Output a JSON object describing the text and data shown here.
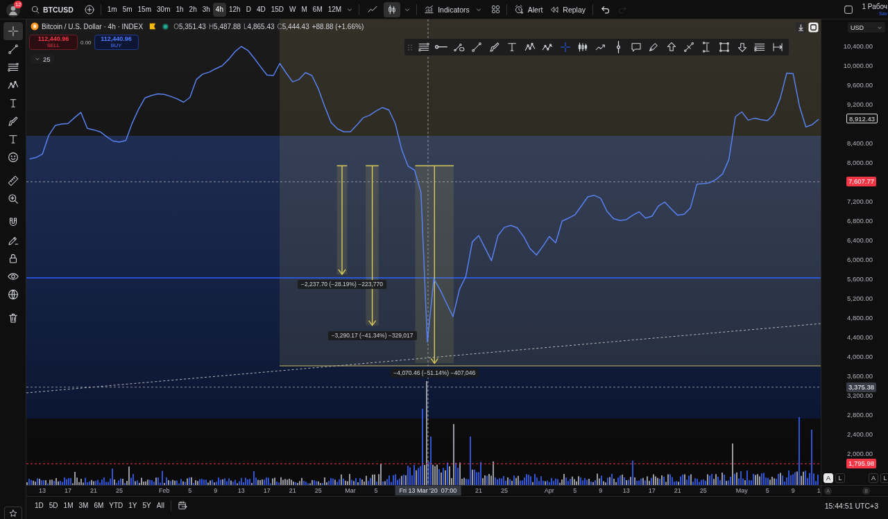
{
  "top_toolbar": {
    "notification_count": "12",
    "symbol": "BTCUSD",
    "intervals": [
      {
        "label": "1m",
        "selected": false
      },
      {
        "label": "5m",
        "selected": false
      },
      {
        "label": "15m",
        "selected": false
      },
      {
        "label": "30m",
        "selected": false
      },
      {
        "label": "1h",
        "selected": false
      },
      {
        "label": "2h",
        "selected": false
      },
      {
        "label": "3h",
        "selected": false
      },
      {
        "label": "4h",
        "selected": true
      },
      {
        "label": "12h",
        "selected": false
      },
      {
        "label": "D",
        "selected": false
      },
      {
        "label": "4D",
        "selected": false
      },
      {
        "label": "15D",
        "selected": false
      },
      {
        "label": "W",
        "selected": false
      },
      {
        "label": "M",
        "selected": false
      },
      {
        "label": "6M",
        "selected": false
      },
      {
        "label": "12M",
        "selected": false
      }
    ],
    "chart_types": [
      {
        "kind": "line",
        "selected": false
      },
      {
        "kind": "candles",
        "selected": true
      }
    ],
    "indicators_label": "Indicators",
    "alert_label": "Alert",
    "replay_label": "Replay",
    "history": [
      {
        "kind": "undo",
        "disabled": false
      },
      {
        "kind": "redo",
        "disabled": true
      }
    ],
    "layout_name": "1 Рабоч",
    "save_status": "Sav"
  },
  "left_toolbar": {
    "groups": [
      {
        "tools": [
          {
            "kind": "crosshair",
            "selected": true
          },
          {
            "kind": "trend-line",
            "selected": false
          },
          {
            "kind": "fib-lines",
            "selected": false
          },
          {
            "kind": "xabcd",
            "selected": false
          },
          {
            "kind": "projection",
            "selected": false
          },
          {
            "kind": "brush",
            "selected": false
          },
          {
            "kind": "text",
            "selected": false
          },
          {
            "kind": "emoji",
            "selected": false
          }
        ]
      },
      {
        "tools": [
          {
            "kind": "ruler",
            "selected": false
          },
          {
            "kind": "zoom-in",
            "selected": false
          }
        ]
      },
      {
        "tools": [
          {
            "kind": "magnet",
            "selected": false
          },
          {
            "kind": "draw-mode",
            "selected": false
          },
          {
            "kind": "lock",
            "selected": false
          },
          {
            "kind": "eye",
            "selected": false
          },
          {
            "kind": "object-tree",
            "selected": false
          }
        ]
      },
      {
        "tools": [
          {
            "kind": "trash",
            "selected": false
          }
        ]
      }
    ]
  },
  "legend": {
    "title": "Bitcoin / U.S. Dollar · 4h · INDEX",
    "ohlc": [
      {
        "key": "O",
        "value": "5,351.43"
      },
      {
        "key": "H",
        "value": "5,487.88"
      },
      {
        "key": "L",
        "value": "4,865.43"
      },
      {
        "key": "C",
        "value": "5,444.43"
      }
    ],
    "change": "+88.88 (+1.66%)"
  },
  "trade": {
    "sell": {
      "price": "112,440.96",
      "label": "SELL"
    },
    "spread": "0.00",
    "buy": {
      "price": "112,440.96",
      "label": "BUY"
    }
  },
  "collapse_toggle": {
    "count": "25"
  },
  "drawing_toolbar": {
    "tools": [
      {
        "kind": "fib-lines",
        "selected": false
      },
      {
        "kind": "ray",
        "selected": false
      },
      {
        "kind": "info-line",
        "selected": false
      },
      {
        "kind": "trend-line",
        "selected": false
      },
      {
        "kind": "brush",
        "selected": false
      },
      {
        "kind": "text",
        "selected": false
      },
      {
        "kind": "xabcd",
        "selected": false
      },
      {
        "kind": "abcd",
        "selected": false
      },
      {
        "kind": "crosshair",
        "selected": true
      },
      {
        "kind": "bars",
        "selected": false
      },
      {
        "kind": "forecast",
        "selected": false
      },
      {
        "kind": "vertical-line",
        "selected": false
      },
      {
        "kind": "callout",
        "selected": false
      },
      {
        "kind": "pen",
        "selected": false
      },
      {
        "kind": "arrow-up",
        "selected": false
      },
      {
        "kind": "parallel",
        "selected": false
      },
      {
        "kind": "price-range",
        "selected": false
      },
      {
        "kind": "rectangle",
        "selected": false
      },
      {
        "kind": "arrow-down",
        "selected": false
      },
      {
        "kind": "fib-channel",
        "selected": false
      },
      {
        "kind": "date-range",
        "selected": false
      }
    ]
  },
  "chart": {
    "currency": "USD",
    "chart_data": {
      "type": "line",
      "categories": [
        null,
        null,
        "13",
        null,
        null,
        null,
        "17",
        null,
        null,
        null,
        "21",
        null,
        null,
        null,
        "25",
        null,
        null,
        null,
        null,
        null,
        null,
        "Feb",
        null,
        null,
        null,
        "5",
        null,
        null,
        null,
        "9",
        null,
        null,
        null,
        "13",
        null,
        null,
        null,
        "17",
        null,
        null,
        null,
        "21",
        null,
        null,
        null,
        "25",
        null,
        null,
        null,
        null,
        "Mar",
        null,
        null,
        null,
        "5",
        null,
        null,
        null,
        null,
        null,
        null,
        null,
        null,
        null,
        null,
        null,
        null,
        null,
        null,
        null,
        "21",
        null,
        null,
        null,
        "25",
        null,
        null,
        null,
        null,
        null,
        null,
        "Apr",
        null,
        null,
        null,
        "5",
        null,
        null,
        null,
        "9",
        null,
        null,
        null,
        "13",
        null,
        null,
        null,
        "17",
        null,
        null,
        null,
        "21",
        null,
        null,
        null,
        "25",
        null,
        null,
        null,
        null,
        null,
        "May",
        null,
        null,
        null,
        "5",
        null,
        null,
        null,
        "9",
        null,
        null,
        null,
        "1"
      ],
      "series": [
        {
          "color": "#5a82f0",
          "values": [
            8080,
            8110,
            8180,
            8570,
            8770,
            8800,
            8810,
            8930,
            9040,
            8710,
            8680,
            8640,
            8540,
            8450,
            8430,
            8460,
            8820,
            9110,
            9340,
            9390,
            9420,
            9410,
            9370,
            9320,
            9250,
            9350,
            9720,
            9830,
            9870,
            9940,
            10000,
            10130,
            10290,
            10400,
            10320,
            10160,
            9980,
            9810,
            9800,
            10050,
            9850,
            9670,
            9720,
            9860,
            9800,
            9530,
            9160,
            8830,
            8700,
            8640,
            8640,
            8780,
            8930,
            8980,
            9070,
            9140,
            9090,
            8810,
            8270,
            7930,
            7850,
            7390,
            4300,
            5610,
            5380,
            5100,
            4830,
            5390,
            5660,
            6370,
            6500,
            6240,
            5980,
            6500,
            6670,
            6710,
            6660,
            6480,
            6230,
            6100,
            6280,
            6480,
            6350,
            6800,
            6860,
            6930,
            7110,
            7300,
            7330,
            7270,
            7000,
            6850,
            6810,
            6830,
            6920,
            6990,
            6860,
            6900,
            7110,
            7190,
            7050,
            6920,
            6940,
            7070,
            7560,
            7570,
            7590,
            7660,
            7770,
            8070,
            8950,
            9050,
            8880,
            8920,
            8890,
            8870,
            9000,
            9330,
            9850,
            9840,
            9160,
            8740,
            8790,
            8900
          ]
        }
      ],
      "ylim": [
        1357,
        10957
      ],
      "yticks": [
        {
          "value": 10400,
          "label": "10,400.00"
        },
        {
          "value": 10000,
          "label": "10,000.00"
        },
        {
          "value": 9600,
          "label": "9,600.00"
        },
        {
          "value": 9200,
          "label": "9,200.00"
        },
        {
          "value": 8400,
          "label": "8,400.00"
        },
        {
          "value": 8000,
          "label": "8,000.00"
        },
        {
          "value": 7200,
          "label": "7,200.00"
        },
        {
          "value": 6800,
          "label": "6,800.00"
        },
        {
          "value": 6400,
          "label": "6,400.00"
        },
        {
          "value": 6000,
          "label": "6,000.00"
        },
        {
          "value": 5600,
          "label": "5,600.00"
        },
        {
          "value": 5200,
          "label": "5,200.00"
        },
        {
          "value": 4800,
          "label": "4,800.00"
        },
        {
          "value": 4400,
          "label": "4,400.00"
        },
        {
          "value": 4000,
          "label": "4,000.00"
        },
        {
          "value": 3600,
          "label": "3,600.00"
        },
        {
          "value": 3200,
          "label": "3,200.00"
        },
        {
          "value": 2800,
          "label": "2,800.00"
        },
        {
          "value": 2400,
          "label": "2,400.00"
        },
        {
          "value": 2000,
          "label": "2,000.00"
        }
      ]
    },
    "measurements": [
      "−2,237.70 (−28.19%) −223,770",
      "−3,290.17 (−41.34%) −329,017",
      "−4,070.46 (−51.14%) −407,046"
    ],
    "crosshair_time": "Fri 13 Mar '20  07:00",
    "price_labels": [
      {
        "kind": "last",
        "text": "8,912.43"
      },
      {
        "kind": "line",
        "text": "7,607.77",
        "color": "#f23645"
      },
      {
        "kind": "line",
        "text": "3,375.38",
        "color": "#3a3d48"
      },
      {
        "kind": "alert",
        "text": "1,795.98",
        "color": "#f23645"
      }
    ],
    "scale_buttons": [
      {
        "label": "A",
        "selected": true
      },
      {
        "label": "L",
        "selected": false
      },
      {
        "label": "A",
        "selected": false
      },
      {
        "label": "L",
        "selected": false
      }
    ],
    "markers": [
      "A",
      "B"
    ]
  },
  "range_bar": {
    "ranges": [
      {
        "label": "1D",
        "selected": false
      },
      {
        "label": "5D",
        "selected": false
      },
      {
        "label": "1M",
        "selected": false
      },
      {
        "label": "3M",
        "selected": false
      },
      {
        "label": "6M",
        "selected": false
      },
      {
        "label": "YTD",
        "selected": false
      },
      {
        "label": "1Y",
        "selected": false
      },
      {
        "label": "5Y",
        "selected": false
      },
      {
        "label": "All",
        "selected": false
      }
    ],
    "clock": "15:44:51 UTC+3"
  }
}
